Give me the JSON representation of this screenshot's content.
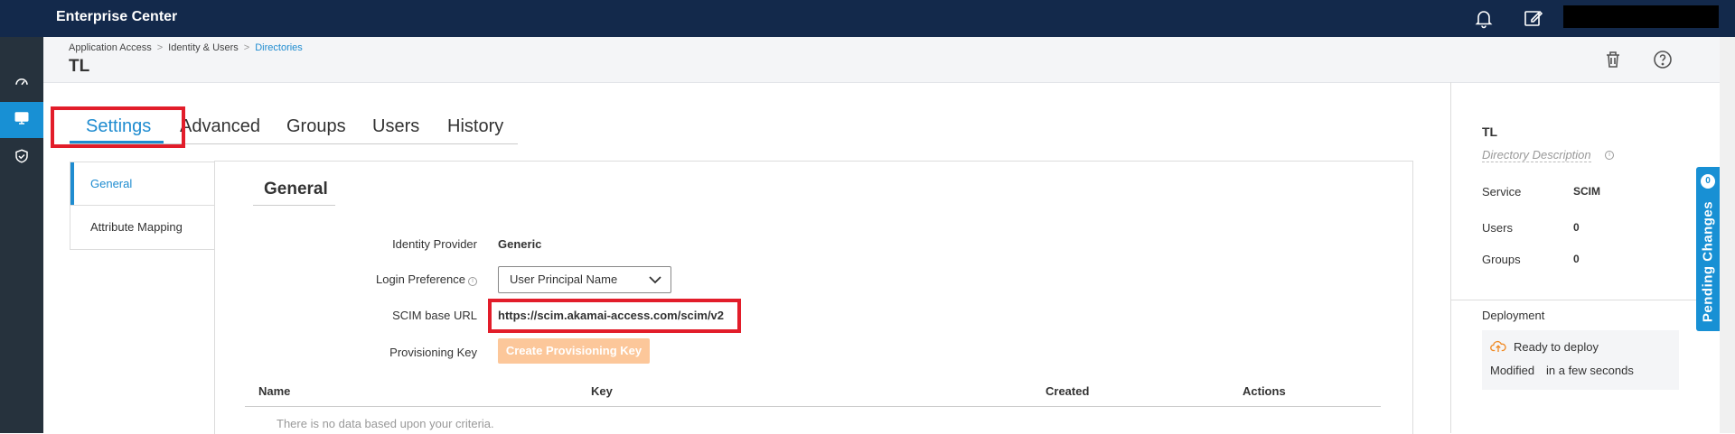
{
  "app": {
    "title": "Enterprise Center"
  },
  "breadcrumb": [
    "Application Access",
    "Identity & Users",
    "Directories"
  ],
  "page": {
    "title": "TL"
  },
  "tabs": [
    "Settings",
    "Advanced",
    "Groups",
    "Users",
    "History"
  ],
  "subnav": [
    "General",
    "Attribute Mapping"
  ],
  "general": {
    "title": "General",
    "identity_provider": {
      "label": "Identity Provider",
      "value": "Generic"
    },
    "login_preference": {
      "label": "Login Preference",
      "value": "User Principal Name"
    },
    "scim_url": {
      "label": "SCIM base URL",
      "value": "https://scim.akamai-access.com/scim/v2"
    },
    "provisioning_key": {
      "label": "Provisioning Key",
      "button": "Create Provisioning Key"
    }
  },
  "table": {
    "columns": [
      "Name",
      "Key",
      "Created",
      "Actions"
    ],
    "empty_message": "There is no data based upon your criteria."
  },
  "sidebar": {
    "title": "TL",
    "description_placeholder": "Directory Description",
    "service": {
      "label": "Service",
      "value": "SCIM"
    },
    "users": {
      "label": "Users",
      "value": "0"
    },
    "groups": {
      "label": "Groups",
      "value": "0"
    },
    "deployment": {
      "label": "Deployment",
      "status": "Ready to deploy",
      "modified_label": "Modified",
      "modified_value": "in a few seconds"
    }
  },
  "pending_changes": {
    "label": "Pending Changes",
    "count": "0"
  },
  "colors": {
    "accent": "#1f8cd0",
    "topbar": "#13294b",
    "highlight": "#e21d2a",
    "button_disabled": "#fcc79a"
  },
  "icons": [
    "dashboard-icon",
    "monitor-icon",
    "shield-check-icon",
    "bell-icon",
    "edit-icon",
    "trash-icon",
    "help-icon",
    "chevron-down-icon",
    "cloud-upload-icon",
    "info-icon"
  ]
}
